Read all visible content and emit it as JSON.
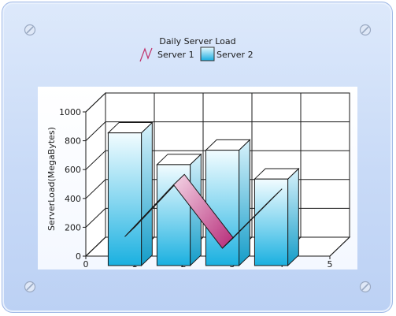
{
  "chart_data": {
    "type": "bar",
    "title": "Daily Server Load",
    "ylabel": "ServerLoad(MegaBytes)",
    "xlabel": "",
    "ylim": [
      0,
      1000
    ],
    "xlim": [
      0,
      5
    ],
    "x_ticks": [
      0,
      1,
      2,
      3,
      4,
      5
    ],
    "y_ticks": [
      0,
      200,
      400,
      600,
      800,
      1000
    ],
    "grid": true,
    "legend_position": "top-center",
    "series": [
      {
        "name": "Server 1",
        "type": "line",
        "x": [
          1,
          2,
          3,
          4
        ],
        "values": [
          200,
          560,
          120,
          460
        ],
        "color": "#c0306a"
      },
      {
        "name": "Server 2",
        "type": "bar",
        "x": [
          1,
          2,
          3,
          4
        ],
        "values": [
          920,
          700,
          800,
          600
        ],
        "color": "#1ab0e0"
      }
    ]
  }
}
